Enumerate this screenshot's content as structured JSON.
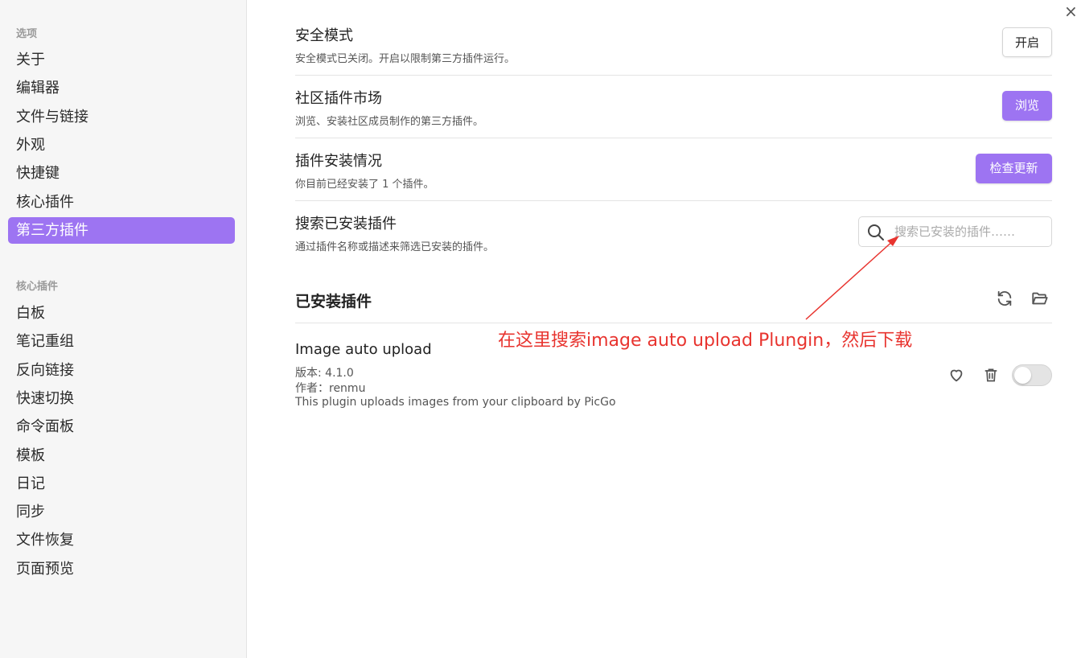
{
  "sidebar": {
    "options_title": "选项",
    "options_items": [
      {
        "label": "关于"
      },
      {
        "label": "编辑器"
      },
      {
        "label": "文件与链接"
      },
      {
        "label": "外观"
      },
      {
        "label": "快捷键"
      },
      {
        "label": "核心插件"
      },
      {
        "label": "第三方插件",
        "active": true
      }
    ],
    "core_title": "核心插件",
    "core_items": [
      {
        "label": "白板"
      },
      {
        "label": "笔记重组"
      },
      {
        "label": "反向链接"
      },
      {
        "label": "快速切换"
      },
      {
        "label": "命令面板"
      },
      {
        "label": "模板"
      },
      {
        "label": "日记"
      },
      {
        "label": "同步"
      },
      {
        "label": "文件恢复"
      },
      {
        "label": "页面预览"
      }
    ]
  },
  "main": {
    "close_glyph": "×",
    "safe_mode": {
      "name": "安全模式",
      "desc": "安全模式已关闭。开启以限制第三方插件运行。",
      "button": "开启"
    },
    "community": {
      "name": "社区插件市场",
      "desc": "浏览、安装社区成员制作的第三方插件。",
      "button": "浏览"
    },
    "install_status": {
      "name": "插件安装情况",
      "desc": "你目前已经安装了 1 个插件。",
      "button": "检查更新"
    },
    "search": {
      "name": "搜索已安装插件",
      "desc": "通过插件名称或描述来筛选已安装的插件。",
      "placeholder": "搜索已安装的插件……",
      "value": ""
    },
    "installed_title": "已安装插件",
    "plugin": {
      "name": "Image auto upload",
      "version": "版本: 4.1.0",
      "author": "作者：renmu",
      "description": "This plugin uploads images from your clipboard by PicGo",
      "enabled": false
    },
    "annotation": "在这里搜索image auto upload Plungin，然后下载"
  },
  "colors": {
    "accent": "#9d74f2",
    "annotation": "#e8342f",
    "sidebar_bg": "#f6f6f6"
  },
  "icons": [
    "search-icon",
    "refresh-icon",
    "folder-open-icon",
    "heart-icon",
    "trash-icon",
    "close-icon"
  ]
}
